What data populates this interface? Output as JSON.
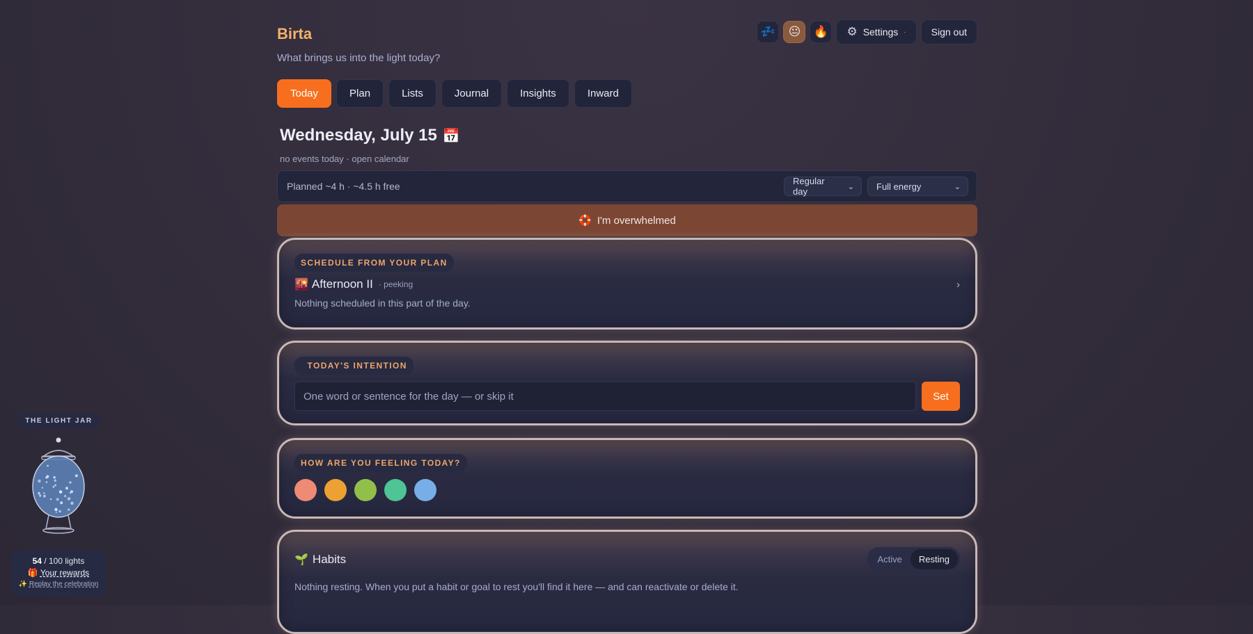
{
  "app": {
    "brand": "Birta",
    "tagline": "What brings us into the light today?"
  },
  "topbar": {
    "mood_icons": [
      {
        "name": "sleepy-icon",
        "glyph": "💤",
        "active": false
      },
      {
        "name": "neutral-face-icon",
        "glyph": "😐",
        "active": true
      },
      {
        "name": "fire-icon",
        "glyph": "🔥",
        "active": false
      }
    ],
    "settings_icon": "gear-icon",
    "settings_glyph": "⚙",
    "settings_label": "Settings",
    "settings_dot": "·",
    "signout_label": "Sign out"
  },
  "tabs": [
    {
      "label": "Today",
      "active": true
    },
    {
      "label": "Plan",
      "active": false
    },
    {
      "label": "Lists",
      "active": false
    },
    {
      "label": "Journal",
      "active": false
    },
    {
      "label": "Insights",
      "active": false
    },
    {
      "label": "Inward",
      "active": false
    }
  ],
  "day": {
    "title": "Wednesday, July 15",
    "calendar_glyph": "📅",
    "subtitle": "no events today · open calendar"
  },
  "plan_bar": {
    "summary": "Planned ~4 h · ~4.5 h free",
    "day_type": "Regular day",
    "energy": "Full energy"
  },
  "overwhelm": {
    "icon_glyph": "🛟",
    "label": "I'm overwhelmed"
  },
  "schedule_card": {
    "chip": "SCHEDULE FROM YOUR PLAN",
    "period_glyph": "🌇",
    "period": "Afternoon II",
    "status": "· peeking",
    "chevron": "›",
    "empty": "Nothing scheduled in this part of the day."
  },
  "intention_card": {
    "chip": "TODAY'S INTENTION",
    "placeholder": "One word or sentence for the day — or skip it",
    "value": "",
    "set_label": "Set"
  },
  "feeling_card": {
    "chip": "HOW ARE YOU FEELING TODAY?",
    "options": [
      {
        "name": "feeling-option-1",
        "color": "#ef8a75"
      },
      {
        "name": "feeling-option-2",
        "color": "#eda132"
      },
      {
        "name": "feeling-option-3",
        "color": "#92bf4a"
      },
      {
        "name": "feeling-option-4",
        "color": "#4fc494"
      },
      {
        "name": "feeling-option-5",
        "color": "#78aee8"
      }
    ]
  },
  "habits_card": {
    "glyph": "🌱",
    "title": "Habits",
    "segments": [
      {
        "label": "Active",
        "active": false
      },
      {
        "label": "Resting",
        "active": true
      }
    ],
    "empty": "Nothing resting. When you put a habit or goal to rest you'll find it here — and can reactivate or delete it."
  },
  "light_jar": {
    "label": "THE LIGHT JAR",
    "count": "54",
    "total": "/ 100 lights",
    "progress": 0.54,
    "rewards_glyph": "🎁",
    "rewards_label": "Your rewards",
    "replay_glyph": "✨",
    "replay_label": "Replay the celebration"
  },
  "colors": {
    "accent": "#f76f1e",
    "brand": "#f3b268",
    "chip_text": "#f0a46a",
    "overwhelm": "#7b4633"
  }
}
